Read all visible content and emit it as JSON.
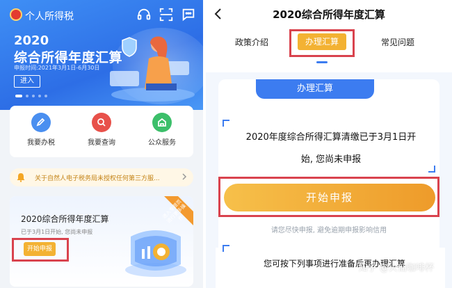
{
  "left": {
    "app_title": "个人所得税",
    "hero": {
      "year": "2020",
      "title": "综合所得年度汇算",
      "date": "申报时间:2021年3月1日-6月30日",
      "enter_label": "进入"
    },
    "services": [
      {
        "label": "我要办税",
        "icon": "edit-icon",
        "color": "#4a8ff0"
      },
      {
        "label": "我要查询",
        "icon": "search-icon",
        "color": "#e8514a"
      },
      {
        "label": "公众服务",
        "icon": "service-icon",
        "color": "#3cbf6a"
      }
    ],
    "notice": "关于自然人电子税务局未授权任何第三方服...",
    "promo": {
      "title": "2020综合所得年度汇算",
      "subtitle": "已于3月1日开始, 您尚未申报",
      "button": "开始申报",
      "ribbon": "进入专题页 进行更多操作"
    }
  },
  "right": {
    "title": "2020综合所得年度汇算",
    "tabs": [
      "政策介绍",
      "办理汇算",
      "常见问题"
    ],
    "card_header": "办理汇算",
    "message_line1": "2020年度综合所得汇算清缴已于3月1日开",
    "message_line2": "始, 您尚未申报",
    "start_button": "开始申报",
    "hint": "请您尽快申报, 避免逾期申报影响信用",
    "bottom_text": "您可按下列事项进行准备后再办理汇算",
    "watermark": "知乎 @火仙咖啡杯"
  },
  "colors": {
    "primary_blue": "#3c7cf0",
    "accent_orange": "#f3b233",
    "highlight_red": "#d9434e"
  }
}
